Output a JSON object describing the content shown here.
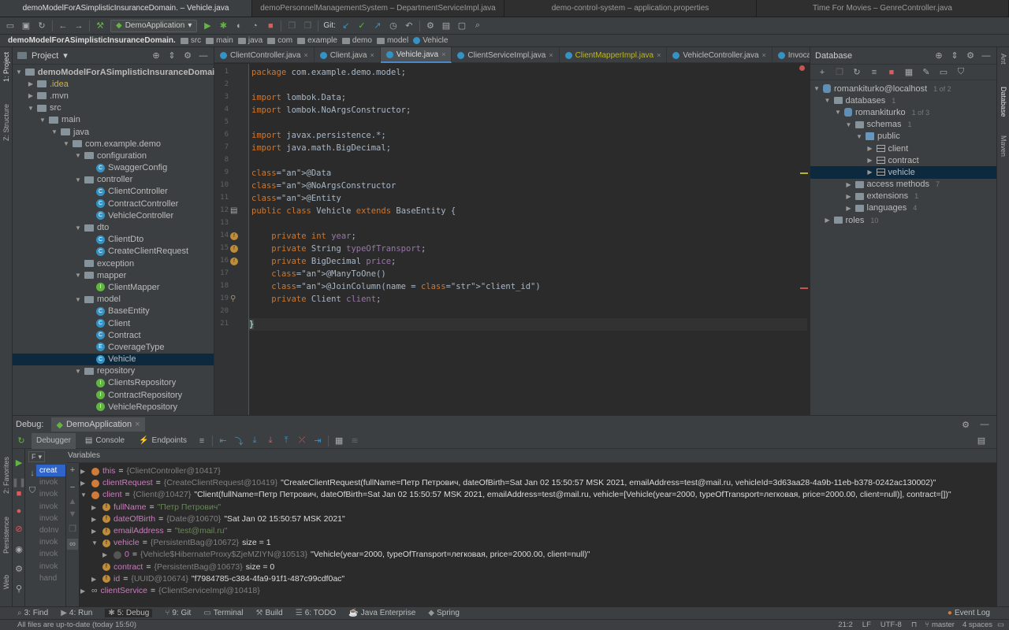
{
  "window_tabs": [
    "demoModelForASimplisticInsuranceDomain. – Vehicle.java",
    "demoPersonnelManagementSystem – DepartmentServiceImpl.java",
    "demo-control-system – application.properties",
    "Time For Movies – GenreController.java"
  ],
  "toolbar": {
    "run_config": "DemoApplication",
    "git_label": "Git:"
  },
  "breadcrumb": [
    "demoModelForASimplisticInsuranceDomain.",
    "src",
    "main",
    "java",
    "com",
    "example",
    "demo",
    "model",
    "Vehicle"
  ],
  "left_strip": {
    "project": "1: Project",
    "structure": "Z: Structure",
    "favorites": "2: Favorites",
    "persistence": "Persistence",
    "web": "Web"
  },
  "right_strip": {
    "ant": "Ant",
    "database": "Database",
    "maven": "Maven"
  },
  "project": {
    "title": "Project",
    "items": [
      {
        "label": "demoModelForASimplisticInsuranceDomain.",
        "indent": 0,
        "icon": "folder",
        "open": true,
        "bold": true
      },
      {
        "label": ".idea",
        "indent": 1,
        "icon": "folder",
        "open": false,
        "color": "#d0b344"
      },
      {
        "label": ".mvn",
        "indent": 1,
        "icon": "folder",
        "open": false
      },
      {
        "label": "src",
        "indent": 1,
        "icon": "folder",
        "open": true
      },
      {
        "label": "main",
        "indent": 2,
        "icon": "folder",
        "open": true
      },
      {
        "label": "java",
        "indent": 3,
        "icon": "folder",
        "open": true
      },
      {
        "label": "com.example.demo",
        "indent": 4,
        "icon": "pkg",
        "open": true
      },
      {
        "label": "configuration",
        "indent": 5,
        "icon": "pkg",
        "open": true
      },
      {
        "label": "SwaggerConfig",
        "indent": 6,
        "icon": "class"
      },
      {
        "label": "controller",
        "indent": 5,
        "icon": "pkg",
        "open": true
      },
      {
        "label": "ClientController",
        "indent": 6,
        "icon": "class"
      },
      {
        "label": "ContractController",
        "indent": 6,
        "icon": "class"
      },
      {
        "label": "VehicleController",
        "indent": 6,
        "icon": "class"
      },
      {
        "label": "dto",
        "indent": 5,
        "icon": "pkg",
        "open": true
      },
      {
        "label": "ClientDto",
        "indent": 6,
        "icon": "class"
      },
      {
        "label": "CreateClientRequest",
        "indent": 6,
        "icon": "class"
      },
      {
        "label": "exception",
        "indent": 5,
        "icon": "pkg",
        "leaf": true
      },
      {
        "label": "mapper",
        "indent": 5,
        "icon": "pkg",
        "open": true
      },
      {
        "label": "ClientMapper",
        "indent": 6,
        "icon": "int"
      },
      {
        "label": "model",
        "indent": 5,
        "icon": "pkg",
        "open": true
      },
      {
        "label": "BaseEntity",
        "indent": 6,
        "icon": "class"
      },
      {
        "label": "Client",
        "indent": 6,
        "icon": "class"
      },
      {
        "label": "Contract",
        "indent": 6,
        "icon": "class"
      },
      {
        "label": "CoverageType",
        "indent": 6,
        "icon": "enum"
      },
      {
        "label": "Vehicle",
        "indent": 6,
        "icon": "class",
        "selected": true
      },
      {
        "label": "repository",
        "indent": 5,
        "icon": "pkg",
        "open": true
      },
      {
        "label": "ClientsRepository",
        "indent": 6,
        "icon": "int"
      },
      {
        "label": "ContractRepository",
        "indent": 6,
        "icon": "int"
      },
      {
        "label": "VehicleRepository",
        "indent": 6,
        "icon": "int"
      }
    ]
  },
  "editor_tabs": [
    {
      "label": "ClientController.java"
    },
    {
      "label": "Client.java"
    },
    {
      "label": "Vehicle.java",
      "active": true
    },
    {
      "label": "ClientServiceImpl.java"
    },
    {
      "label": "ClientMapperImpl.java",
      "color": "#bbb529"
    },
    {
      "label": "VehicleController.java"
    },
    {
      "label": "InvocableHandle"
    }
  ],
  "code_lines": [
    "package com.example.demo.model;",
    "",
    "import lombok.Data;",
    "import lombok.NoArgsConstructor;",
    "",
    "import javax.persistence.*;",
    "import java.math.BigDecimal;",
    "",
    "@Data",
    "@NoArgsConstructor",
    "@Entity",
    "public class Vehicle extends BaseEntity {",
    "",
    "    private int year;",
    "    private String typeOfTransport;",
    "    private BigDecimal price;",
    "    @ManyToOne()",
    "    @JoinColumn(name = \"client_id\")",
    "    private Client client;",
    "",
    "}"
  ],
  "database": {
    "title": "Database",
    "items": [
      {
        "label": "romankiturko@localhost",
        "badge": "1 of 2",
        "indent": 0,
        "icon": "db",
        "open": true
      },
      {
        "label": "databases",
        "badge": "1",
        "indent": 1,
        "icon": "dir",
        "open": true
      },
      {
        "label": "romankiturko",
        "badge": "1 of 3",
        "indent": 2,
        "icon": "db",
        "open": true
      },
      {
        "label": "schemas",
        "badge": "1",
        "indent": 3,
        "icon": "dir",
        "open": true
      },
      {
        "label": "public",
        "badge": "",
        "indent": 4,
        "icon": "schema",
        "open": true
      },
      {
        "label": "client",
        "badge": "",
        "indent": 5,
        "icon": "tbl",
        "open": false
      },
      {
        "label": "contract",
        "badge": "",
        "indent": 5,
        "icon": "tbl",
        "open": false
      },
      {
        "label": "vehicle",
        "badge": "",
        "indent": 5,
        "icon": "tbl",
        "open": false,
        "selected": true
      },
      {
        "label": "access methods",
        "badge": "7",
        "indent": 3,
        "icon": "dir",
        "open": false
      },
      {
        "label": "extensions",
        "badge": "1",
        "indent": 3,
        "icon": "dir",
        "open": false
      },
      {
        "label": "languages",
        "badge": "4",
        "indent": 3,
        "icon": "dir",
        "open": false
      },
      {
        "label": "roles",
        "badge": "10",
        "indent": 1,
        "icon": "dir",
        "open": false
      }
    ]
  },
  "debug": {
    "title": "Debug:",
    "config": "DemoApplication",
    "tabs": [
      "Debugger",
      "Console",
      "Endpoints"
    ],
    "frames_label": "F",
    "variables_label": "Variables",
    "frames": [
      "creat",
      "invok",
      "invok",
      "invok",
      "invok",
      "doInv",
      "invok",
      "invok",
      "invok",
      "hand"
    ],
    "vars": [
      {
        "indent": 0,
        "arrow": "▶",
        "icon": "p",
        "name": "this",
        "type": "{ClientController@10417}",
        "value": ""
      },
      {
        "indent": 0,
        "arrow": "▶",
        "icon": "p",
        "name": "clientRequest",
        "type": "{CreateClientRequest@10419}",
        "value": "\"CreateClientRequest(fullName=Петр Петрович, dateOfBirth=Sat Jan 02 15:50:57 MSK 2021, emailAddress=test@mail.ru, vehicleId=3d63aa28-4a9b-11eb-b378-0242ac130002)\""
      },
      {
        "indent": 0,
        "arrow": "▼",
        "icon": "p",
        "name": "client",
        "type": "{Client@10427}",
        "value": "\"Client(fullName=Петр Петрович, dateOfBirth=Sat Jan 02 15:50:57 MSK 2021, emailAddress=test@mail.ru, vehicle=[Vehicle(year=2000, typeOfTransport=легковая, price=2000.00, client=null)], contract=[])\""
      },
      {
        "indent": 1,
        "arrow": "▶",
        "icon": "f",
        "name": "fullName",
        "type": "",
        "value": "",
        "str": "\"Петр Петрович\""
      },
      {
        "indent": 1,
        "arrow": "▶",
        "icon": "f",
        "name": "dateOfBirth",
        "type": "{Date@10670}",
        "value": "\"Sat Jan 02 15:50:57 MSK 2021\""
      },
      {
        "indent": 1,
        "arrow": "▶",
        "icon": "f",
        "name": "emailAddress",
        "type": "",
        "value": "",
        "str": "\"test@mail.ru\""
      },
      {
        "indent": 1,
        "arrow": "▼",
        "icon": "f",
        "name": "vehicle",
        "type": "{PersistentBag@10672}",
        "value": " size = 1"
      },
      {
        "indent": 2,
        "arrow": "▶",
        "icon": "",
        "name": "0",
        "type": "{Vehicle$HibernateProxy$ZjeMZIYN@10513}",
        "value": "\"Vehicle(year=2000, typeOfTransport=легковая, price=2000.00, client=null)\""
      },
      {
        "indent": 1,
        "arrow": "",
        "icon": "f",
        "name": "contract",
        "type": "{PersistentBag@10673}",
        "value": " size = 0"
      },
      {
        "indent": 1,
        "arrow": "▶",
        "icon": "f",
        "name": "id",
        "type": "{UUID@10674}",
        "value": "\"f7984785-c384-4fa9-91f1-487c99cdf0ac\""
      },
      {
        "indent": 0,
        "arrow": "▶",
        "icon": "oo",
        "name": "clientService",
        "type": "{ClientServiceImpl@10418}",
        "value": ""
      }
    ]
  },
  "bottom_tabs": [
    {
      "label": "3: Find"
    },
    {
      "label": "4: Run"
    },
    {
      "label": "5: Debug",
      "active": true
    },
    {
      "label": "9: Git"
    },
    {
      "label": "Terminal"
    },
    {
      "label": "Build"
    },
    {
      "label": "6: TODO"
    },
    {
      "label": "Java Enterprise"
    },
    {
      "label": "Spring"
    }
  ],
  "event_log": "Event Log",
  "status": {
    "message": "All files are up-to-date (today 15:50)",
    "position": "21:2",
    "line_sep": "LF",
    "encoding": "UTF-8",
    "branch": "master",
    "indent": "4 spaces"
  }
}
